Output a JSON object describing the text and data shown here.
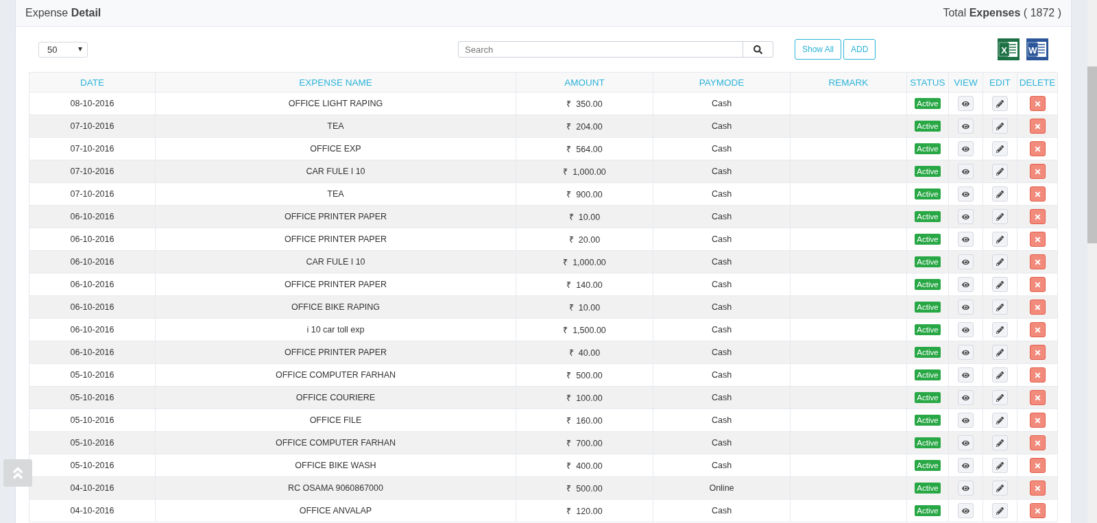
{
  "header": {
    "title_light": "Expense",
    "title_bold": "Detail",
    "total_light": "Total",
    "total_bold": "Expenses",
    "total_count": "( 1872 )"
  },
  "toolbar": {
    "page_size": "50",
    "search": {
      "placeholder": "Search"
    },
    "buttons": [
      "Show All",
      "ADD"
    ],
    "exports": [
      {
        "kind": "excel",
        "letter": "X"
      },
      {
        "kind": "word",
        "letter": "W"
      }
    ]
  },
  "table": {
    "columns": [
      "DATE",
      "EXPENSE NAME",
      "AMOUNT",
      "PAYMODE",
      "REMARK",
      "STATUS",
      "VIEW",
      "EDIT",
      "DELETE"
    ],
    "rows": [
      {
        "date": "08-10-2016",
        "name": "OFFICE LIGHT RAPING",
        "amount": "₹  350.00",
        "paymode": "Cash",
        "status": "Active"
      },
      {
        "date": "07-10-2016",
        "name": "TEA",
        "amount": "₹  204.00",
        "paymode": "Cash",
        "status": "Active"
      },
      {
        "date": "07-10-2016",
        "name": "OFFICE EXP",
        "amount": "₹  564.00",
        "paymode": "Cash",
        "status": "Active"
      },
      {
        "date": "07-10-2016",
        "name": "CAR FULE I 10",
        "amount": "₹  1,000.00",
        "paymode": "Cash",
        "status": "Active"
      },
      {
        "date": "07-10-2016",
        "name": "TEA",
        "amount": "₹  900.00",
        "paymode": "Cash",
        "status": "Active"
      },
      {
        "date": "06-10-2016",
        "name": "OFFICE PRINTER PAPER",
        "amount": "₹  10.00",
        "paymode": "Cash",
        "status": "Active"
      },
      {
        "date": "06-10-2016",
        "name": "OFFICE PRINTER PAPER",
        "amount": "₹  20.00",
        "paymode": "Cash",
        "status": "Active"
      },
      {
        "date": "06-10-2016",
        "name": "CAR FULE I 10",
        "amount": "₹  1,000.00",
        "paymode": "Cash",
        "status": "Active"
      },
      {
        "date": "06-10-2016",
        "name": "OFFICE PRINTER PAPER",
        "amount": "₹  140.00",
        "paymode": "Cash",
        "status": "Active"
      },
      {
        "date": "06-10-2016",
        "name": "OFFICE BIKE RAPING",
        "amount": "₹  10.00",
        "paymode": "Cash",
        "status": "Active"
      },
      {
        "date": "06-10-2016",
        "name": "i 10 car toll exp",
        "amount": "₹  1,500.00",
        "paymode": "Cash",
        "status": "Active"
      },
      {
        "date": "06-10-2016",
        "name": "OFFICE PRINTER PAPER",
        "amount": "₹  40.00",
        "paymode": "Cash",
        "status": "Active"
      },
      {
        "date": "05-10-2016",
        "name": "OFFICE COMPUTER FARHAN",
        "amount": "₹  500.00",
        "paymode": "Cash",
        "status": "Active"
      },
      {
        "date": "05-10-2016",
        "name": "OFFICE COURIERE",
        "amount": "₹  100.00",
        "paymode": "Cash",
        "status": "Active"
      },
      {
        "date": "05-10-2016",
        "name": "OFFICE FILE",
        "amount": "₹  160.00",
        "paymode": "Cash",
        "status": "Active"
      },
      {
        "date": "05-10-2016",
        "name": "OFFICE COMPUTER FARHAN",
        "amount": "₹  700.00",
        "paymode": "Cash",
        "status": "Active"
      },
      {
        "date": "05-10-2016",
        "name": "OFFICE BIKE WASH",
        "amount": "₹  400.00",
        "paymode": "Cash",
        "status": "Active"
      },
      {
        "date": "04-10-2016",
        "name": "RC OSAMA 9060867000",
        "amount": "₹  500.00",
        "paymode": "Online",
        "status": "Active"
      },
      {
        "date": "04-10-2016",
        "name": "OFFICE ANVALAP",
        "amount": "₹  120.00",
        "paymode": "Cash",
        "status": "Active"
      }
    ]
  }
}
